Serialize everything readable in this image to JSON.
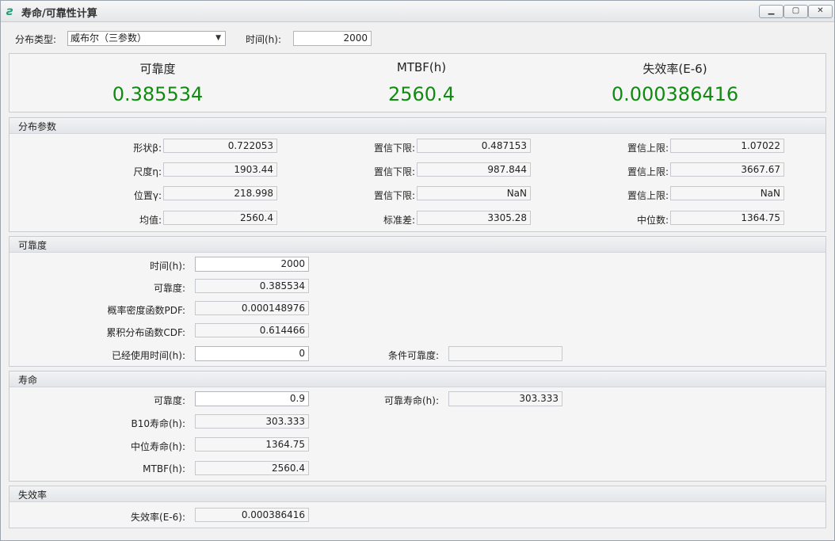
{
  "window": {
    "title": "寿命/可靠性计算",
    "minimize_icon": "minimize-icon",
    "maximize_icon": "maximize-icon",
    "close_icon": "close-icon"
  },
  "top": {
    "dist_type_label": "分布类型:",
    "dist_type_value": "威布尔（三参数）",
    "time_label": "时间(h):",
    "time_value": "2000"
  },
  "summary": {
    "reliability_label": "可靠度",
    "reliability_value": "0.385534",
    "mtbf_label": "MTBF(h)",
    "mtbf_value": "2560.4",
    "failure_rate_label": "失效率(E-6)",
    "failure_rate_value": "0.000386416"
  },
  "params": {
    "title": "分布参数",
    "rows": [
      {
        "label": "形状β:",
        "value": "0.722053",
        "lower_label": "置信下限:",
        "lower": "0.487153",
        "upper_label": "置信上限:",
        "upper": "1.07022"
      },
      {
        "label": "尺度η:",
        "value": "1903.44",
        "lower_label": "置信下限:",
        "lower": "987.844",
        "upper_label": "置信上限:",
        "upper": "3667.67"
      },
      {
        "label": "位置γ:",
        "value": "218.998",
        "lower_label": "置信下限:",
        "lower": "NaN",
        "upper_label": "置信上限:",
        "upper": "NaN"
      },
      {
        "label": "均值:",
        "value": "2560.4",
        "lower_label": "标准差:",
        "lower": "3305.28",
        "upper_label": "中位数:",
        "upper": "1364.75"
      }
    ]
  },
  "reliability": {
    "title": "可靠度",
    "time_label": "时间(h):",
    "time_value": "2000",
    "rel_label": "可靠度:",
    "rel_value": "0.385534",
    "pdf_label": "概率密度函数PDF:",
    "pdf_value": "0.000148976",
    "cdf_label": "累积分布函数CDF:",
    "cdf_value": "0.614466",
    "used_label": "已经使用时间(h):",
    "used_value": "0",
    "cond_label": "条件可靠度:",
    "cond_value": ""
  },
  "life": {
    "title": "寿命",
    "rel_label": "可靠度:",
    "rel_value": "0.9",
    "rel_life_label": "可靠寿命(h):",
    "rel_life_value": "303.333",
    "b10_label": "B10寿命(h):",
    "b10_value": "303.333",
    "median_label": "中位寿命(h):",
    "median_value": "1364.75",
    "mtbf_label": "MTBF(h):",
    "mtbf_value": "2560.4"
  },
  "failure": {
    "title": "失效率",
    "label": "失效率(E-6):",
    "value": "0.000386416"
  },
  "colors": {
    "value_green": "#118a11",
    "panel_bg": "#f5f5f5",
    "app_icon": "#1f9e78"
  }
}
